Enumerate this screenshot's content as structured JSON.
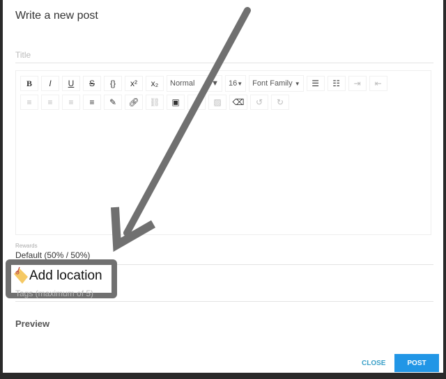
{
  "modal": {
    "title": "Write a new post"
  },
  "form": {
    "title_placeholder": "Title",
    "toolbar": {
      "row1": [
        "B",
        "I",
        "U",
        "S",
        "{}",
        "x²",
        "x₂"
      ],
      "block_format": "Normal",
      "font_size": "16",
      "font_family": "Font Family",
      "row1_icons": [
        "bullet-list-icon",
        "numbered-list-icon",
        "indent-icon",
        "outdent-icon"
      ],
      "row2_icons": [
        "align-left-icon",
        "align-center-icon",
        "align-right-icon",
        "justify-icon",
        "color-picker-icon",
        "link-icon",
        "unlink-icon",
        "embed-icon",
        "emoji-icon",
        "image-icon",
        "eraser-icon",
        "undo-icon",
        "redo-icon"
      ]
    },
    "rewards_label": "Rewards",
    "rewards_value": "Default (50% / 50%)",
    "tags_placeholder": "Tags (maximum of 5)",
    "preview_label": "Preview"
  },
  "annotation": {
    "label": "Add location",
    "arrow_color": "#707070"
  },
  "footer": {
    "close_label": "CLOSE",
    "post_label": "POST",
    "accent": "#2196e6"
  }
}
